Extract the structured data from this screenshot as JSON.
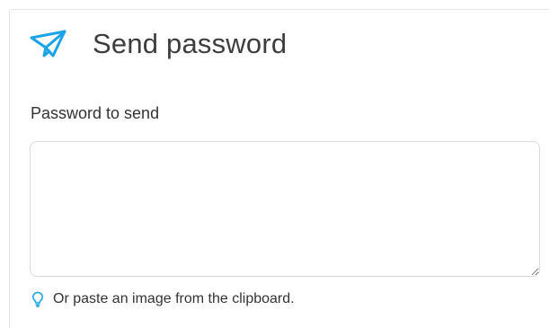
{
  "card": {
    "title": "Send password",
    "title_icon": "paper-plane-icon"
  },
  "form": {
    "password_label": "Password to send",
    "password_value": "",
    "password_placeholder": ""
  },
  "hint": {
    "icon": "lightbulb-icon",
    "text": "Or paste an image from the clipboard."
  },
  "colors": {
    "accent": "#1aa3e8",
    "text": "#333333",
    "border": "#d9d9d9"
  }
}
